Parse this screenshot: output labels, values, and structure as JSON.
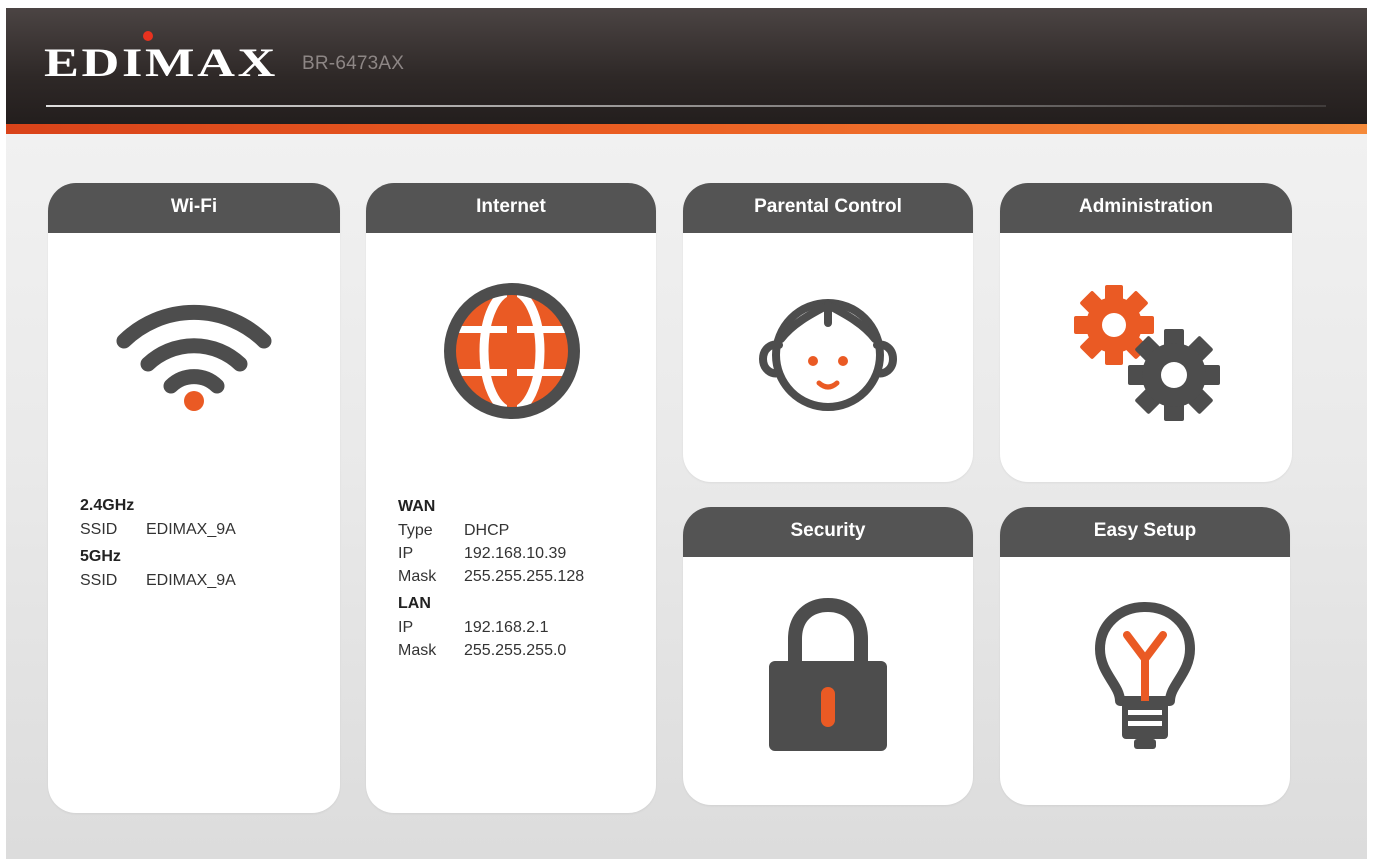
{
  "header": {
    "brand": "EDIMAX",
    "model": "BR-6473AX"
  },
  "colors": {
    "accent": "#ea5a24",
    "tab": "#545454",
    "icon_gray": "#4d4d4d"
  },
  "cards": {
    "wifi": {
      "title": "Wi-Fi",
      "icon": "wifi-icon",
      "band_24": "2.4GHz",
      "ssid_label_24": "SSID",
      "ssid_24": "EDIMAX_9A",
      "band_5": "5GHz",
      "ssid_label_5": "SSID",
      "ssid_5": "EDIMAX_9A"
    },
    "internet": {
      "title": "Internet",
      "icon": "globe-icon",
      "wan": {
        "heading": "WAN",
        "type_label": "Type",
        "type": "DHCP",
        "ip_label": "IP",
        "ip": "192.168.10.39",
        "mask_label": "Mask",
        "mask": "255.255.255.128"
      },
      "lan": {
        "heading": "LAN",
        "ip_label": "IP",
        "ip": "192.168.2.1",
        "mask_label": "Mask",
        "mask": "255.255.255.0"
      }
    },
    "parental": {
      "title": "Parental Control",
      "icon": "child-face-icon"
    },
    "administration": {
      "title": "Administration",
      "icon": "gears-icon"
    },
    "security": {
      "title": "Security",
      "icon": "padlock-icon"
    },
    "easy_setup": {
      "title": "Easy Setup",
      "icon": "lightbulb-icon"
    }
  }
}
